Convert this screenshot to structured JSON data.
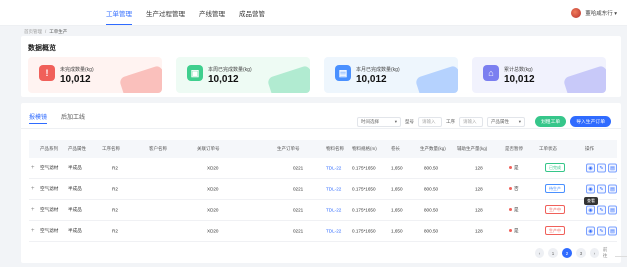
{
  "nav": {
    "tabs": [
      "工单管理",
      "生产过程管理",
      "产线管理",
      "成品营管"
    ],
    "active": 0,
    "user": "董哈咸东行 ▾"
  },
  "breadcrumb": [
    "首页管理",
    "工单生产"
  ],
  "overview": {
    "title": "数据概览",
    "stats": [
      {
        "label": "未完成数量(kg)",
        "value": "10,012",
        "icon": "!",
        "icon_color": "#f0605a",
        "bg": "#fff3f1",
        "icon_name": "alert-icon"
      },
      {
        "label": "本周已完成数量(kg)",
        "value": "10,012",
        "icon": "▣",
        "icon_color": "#3fcf8e",
        "bg": "#eefbf4",
        "icon_name": "calendar-week-icon"
      },
      {
        "label": "本月已完成数量(kg)",
        "value": "10,012",
        "icon": "▤",
        "icon_color": "#4a90ff",
        "bg": "#eef6fd",
        "icon_name": "calendar-month-icon"
      },
      {
        "label": "累计总数(kg)",
        "value": "10,012",
        "icon": "⌂",
        "icon_color": "#7b7ff0",
        "bg": "#f1f2fd",
        "icon_name": "total-icon"
      }
    ]
  },
  "subtabs": [
    "报模镜",
    "后加工线"
  ],
  "filters": {
    "time_select": "时间选择",
    "model_label": "型号",
    "model_placeholder": "请输入",
    "process_label": "工序",
    "process_placeholder": "请输入",
    "attr_select": "产品属性",
    "btn_order": "划粗工单",
    "btn_import": "导入生产订单"
  },
  "table": {
    "headers": [
      "产品系列",
      "产品属性",
      "工序名称",
      "客户名称",
      "关联订单号",
      "生产订单号",
      "物料名称",
      "物料规格(m)",
      "卷长",
      "生产数量(kg)",
      "辅助生产量(kg)",
      "是否暂停",
      "工单状态",
      "操作"
    ],
    "rows": [
      {
        "series": "空气滤材",
        "attr": "半成品",
        "proc": "R2",
        "customer": "",
        "rel": "XD20",
        "order": "0221",
        "material": "TDL-22",
        "spec": "0.175*1650",
        "len": "1,650",
        "qty": "800.50",
        "aux": "128",
        "paused": "是",
        "paused_color": "#f0605a",
        "status": "已完成",
        "status_color": "#36c68a"
      },
      {
        "series": "空气滤材",
        "attr": "半成品",
        "proc": "R2",
        "customer": "",
        "rel": "XD20",
        "order": "0221",
        "material": "TDL-22",
        "spec": "0.175*1650",
        "len": "1,650",
        "qty": "800.50",
        "aux": "128",
        "paused": "否",
        "paused_color": "#f0605a",
        "status": "待生产",
        "status_color": "#4a90ff"
      },
      {
        "series": "空气滤材",
        "attr": "半成品",
        "proc": "R2",
        "customer": "",
        "rel": "XD20",
        "order": "0221",
        "material": "TDL-22",
        "spec": "0.175*1650",
        "len": "1,650",
        "qty": "800.50",
        "aux": "128",
        "paused": "是",
        "paused_color": "#f0605a",
        "status": "生产中",
        "status_color": "#f0605a"
      },
      {
        "series": "空气滤材",
        "attr": "半成品",
        "proc": "R2",
        "customer": "",
        "rel": "XD20",
        "order": "0221",
        "material": "TDL-22",
        "spec": "0.175*1650",
        "len": "1,650",
        "qty": "800.50",
        "aux": "128",
        "paused": "是",
        "paused_color": "#f0605a",
        "status": "生产中",
        "status_color": "#f0605a"
      }
    ]
  },
  "tooltip": "查看",
  "pagination": {
    "pages": [
      "1",
      "2",
      "3"
    ],
    "current": "2",
    "goto": "前往",
    "page_suffix": "页"
  }
}
